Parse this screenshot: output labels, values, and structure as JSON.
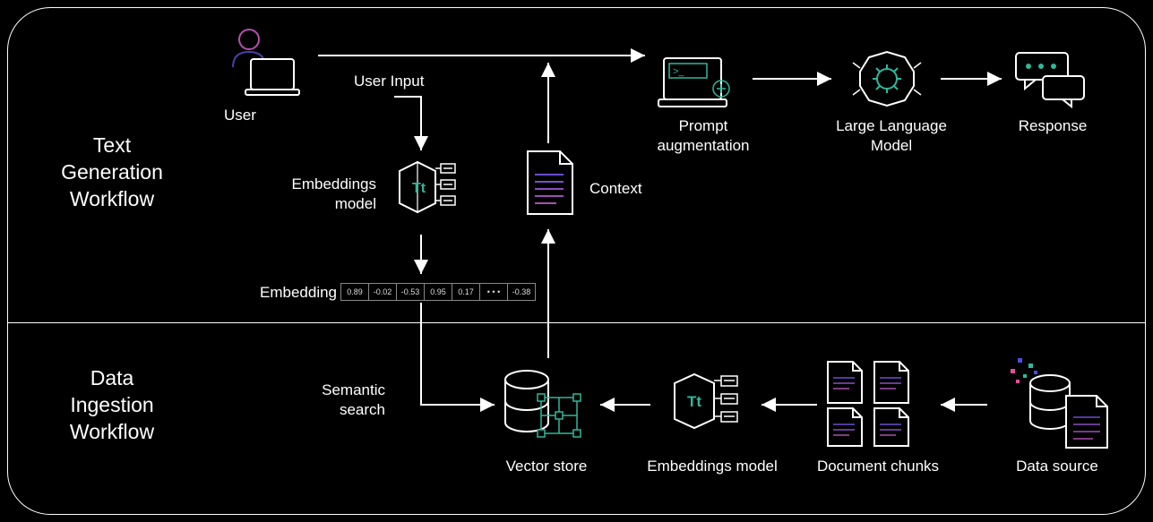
{
  "sections": {
    "top_title_line1": "Text",
    "top_title_line2": "Generation",
    "top_title_line3": "Workflow",
    "bottom_title_line1": "Data",
    "bottom_title_line2": "Ingestion",
    "bottom_title_line3": "Workflow"
  },
  "labels": {
    "user": "User",
    "user_input": "User Input",
    "embeddings_model_top": "Embeddings model",
    "embedding": "Embedding",
    "context": "Context",
    "prompt_aug": "Prompt augmentation",
    "llm": "Large Language Model",
    "response": "Response",
    "semantic_search": "Semantic search",
    "vector_store": "Vector store",
    "embeddings_model_bottom": "Embeddings model",
    "document_chunks": "Document chunks",
    "data_source": "Data source"
  },
  "embedding_vector": [
    "0.89",
    "-0.02",
    "-0.53",
    "0.95",
    "0.17",
    "• • •",
    "-0.38"
  ],
  "tt_glyph": "Tt"
}
